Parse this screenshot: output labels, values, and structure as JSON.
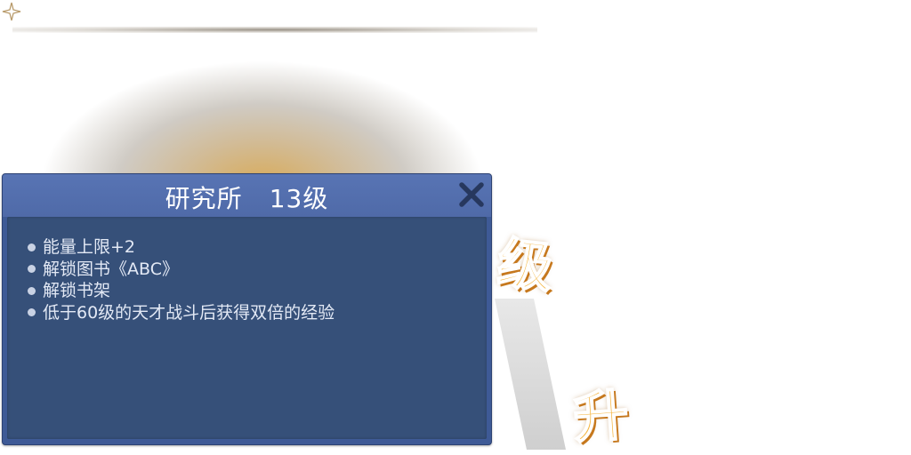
{
  "dialog": {
    "title": "研究所",
    "level": "13级",
    "close_icon": "close-icon"
  },
  "benefits": [
    "能量上限+2",
    "解锁图书《ABC》",
    "解锁书架",
    "低于60级的天才战斗后获得双倍的经验"
  ],
  "decoration": {
    "char_ji": "级",
    "char_sheng": "升"
  },
  "colors": {
    "panel": "#3e5a96",
    "header": "#5874b4",
    "body": "#365079",
    "accent_gold": "#f4b43e"
  }
}
